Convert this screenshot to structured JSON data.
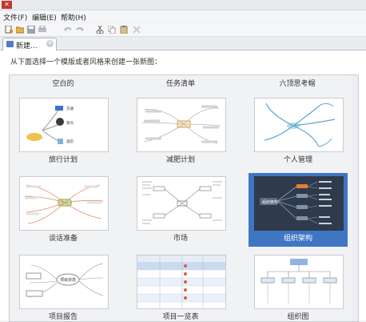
{
  "menu": {
    "file": "文件(F)",
    "edit": "编辑(E)",
    "help": "帮助(H)"
  },
  "toolbar": {
    "icons": [
      "new-icon",
      "open-icon",
      "save-icon",
      "print-icon",
      "undo-icon",
      "redo-icon",
      "cut-icon",
      "copy-icon",
      "paste-icon",
      "delete-icon"
    ]
  },
  "tab": {
    "label": "新建..."
  },
  "main": {
    "instruction": "从下面选择一个模版或者风格来创建一张新图：",
    "top_row_labels": [
      "空白的",
      "任务清单",
      "六顶思考帽"
    ],
    "cards": [
      {
        "label": "旅行计划",
        "selected": false
      },
      {
        "label": "减肥计划",
        "selected": false
      },
      {
        "label": "个人管理",
        "selected": false
      },
      {
        "label": "谈话准备",
        "selected": false
      },
      {
        "label": "市场",
        "selected": false
      },
      {
        "label": "组织架构",
        "selected": true
      },
      {
        "label": "项目报告",
        "selected": false
      },
      {
        "label": "项目一览表",
        "selected": false
      },
      {
        "label": "组织图",
        "selected": false
      }
    ]
  },
  "thumb_text": {
    "travel": [
      "交通",
      "景点",
      "酒店"
    ],
    "org_root": "组织架构",
    "project_report_center": "项目状态"
  },
  "colors": {
    "accent": "#3e76c4",
    "app_logo": "#c0392b"
  }
}
